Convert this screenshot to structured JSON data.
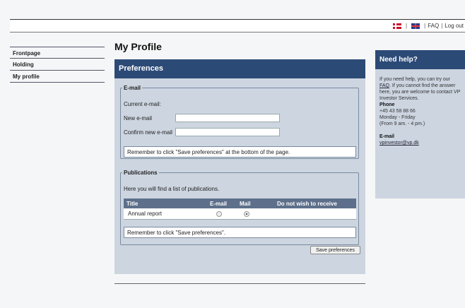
{
  "topnav": {
    "sep": "|",
    "faq": "FAQ",
    "logout": "Log out"
  },
  "sidebar": {
    "items": [
      {
        "label": "Frontpage"
      },
      {
        "label": "Holding"
      },
      {
        "label": "My profile"
      }
    ]
  },
  "main": {
    "title": "My Profile",
    "panel_title": "Preferences",
    "email": {
      "legend": "E-mail",
      "current_label": "Current e-mail:",
      "new_label": "New e-mail",
      "confirm_label": "Confirm new e-mail",
      "new_value": "",
      "confirm_value": "",
      "notice": "Remember to click \"Save preferences\" at the bottom of the page."
    },
    "publications": {
      "legend": "Publications",
      "intro": "Here you will find a list of publications.",
      "headers": {
        "title": "Title",
        "email": "E-mail",
        "mail": "Mail",
        "none": "Do not wish to receive"
      },
      "rows": [
        {
          "title": "Annual report",
          "selected": "Mail"
        }
      ],
      "notice": "Remember to click \"Save preferences\"."
    },
    "save_label": "Save preferences"
  },
  "help": {
    "title": "Need help?",
    "intro_pre": "If you need help, you can try our ",
    "faq_link": "FAQ",
    "intro_post": ". If you cannot find the answer here, you are welcome to contact VP Investor Services.",
    "phone_label": "Phone",
    "phone": "+45 43 58 88 66",
    "days": "Monday - Friday",
    "hours": "(From 9 am. - 4 pm.)",
    "email_label": "E-mail",
    "email": "vpinvestor@vp.dk"
  },
  "colors": {
    "header": "#2c4a76",
    "panel": "#ccd5e0",
    "table_head": "#5d6f8a"
  },
  "icons": [
    "danish-flag-icon",
    "uk-flag-icon"
  ]
}
